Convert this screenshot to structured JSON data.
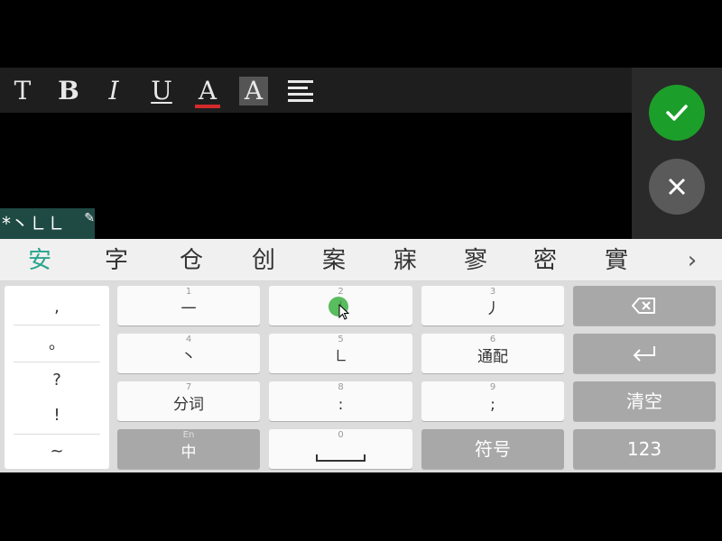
{
  "toolbar": {
    "text_label": "T",
    "bold_label": "B",
    "italic_label": "I",
    "underline_label": "U",
    "font_color_label": "A",
    "highlight_label": "A",
    "font_color_accent": "#d42a2a"
  },
  "actions": {
    "confirm_icon": "check-icon",
    "cancel_icon": "close-icon",
    "confirm_color": "#1c9e2a"
  },
  "stroke_input": {
    "text": "*丶㇗㇗"
  },
  "candidates": [
    "安",
    "字",
    "仓",
    "创",
    "案",
    "寐",
    "寥",
    "密",
    "實"
  ],
  "punctuation": [
    ",",
    "。",
    "?",
    "!",
    "~"
  ],
  "keys": {
    "k1": {
      "num": "1",
      "label": "一"
    },
    "k2": {
      "num": "2",
      "label": "丨"
    },
    "k3": {
      "num": "3",
      "label": "丿"
    },
    "k4": {
      "num": "4",
      "label": "丶"
    },
    "k5": {
      "num": "5",
      "label": "㇗"
    },
    "k6": {
      "num": "6",
      "label": "通配"
    },
    "k7": {
      "num": "7",
      "label": "分词"
    },
    "k8": {
      "num": "8",
      "label": ":"
    },
    "k9": {
      "num": "9",
      "label": ";"
    },
    "k0": {
      "num": "0"
    },
    "clear": {
      "label": "清空"
    },
    "lang": {
      "sub": "En",
      "label": "中"
    },
    "symbols": {
      "label": "符号"
    },
    "numeric": {
      "label": "123"
    }
  }
}
